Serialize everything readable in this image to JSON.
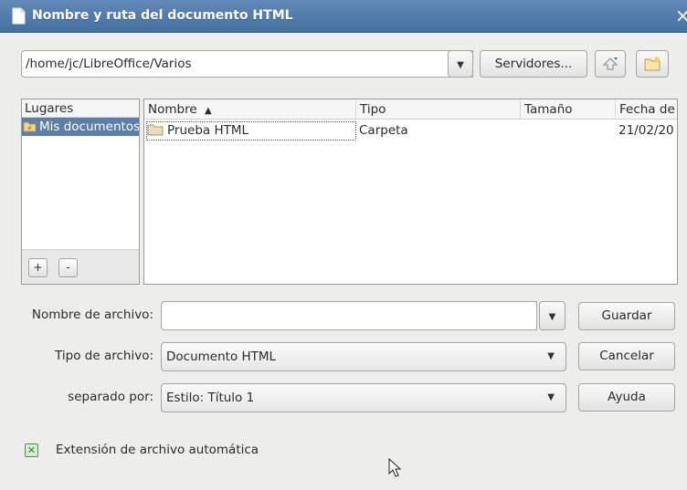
{
  "window": {
    "title": "Nombre y ruta del documento HTML",
    "close_glyph": "×"
  },
  "toolbar": {
    "path": "/home/jc/LibreOffice/Varios",
    "path_dropdown_glyph": "▼",
    "servers_label": "Servidores...",
    "up_icon": "folder-up-icon",
    "new_folder_icon": "new-folder-icon"
  },
  "places": {
    "header": "Lugares",
    "items": [
      {
        "label": "Mis documentos"
      }
    ],
    "add_label": "+",
    "remove_label": "-"
  },
  "files": {
    "columns": {
      "name": "Nombre",
      "sort_glyph": "▲",
      "type": "Tipo",
      "size": "Tamaño",
      "date": "Fecha de"
    },
    "rows": [
      {
        "name": "Prueba HTML",
        "type": "Carpeta",
        "size": "",
        "date": "21/02/20"
      }
    ]
  },
  "form": {
    "filename_label": "Nombre de archivo:",
    "filename_value": "",
    "filetype_label": "Tipo de archivo:",
    "filetype_value": "Documento HTML",
    "separated_label": "separado por:",
    "separated_value": "Estilo: Título 1",
    "dropdown_glyph": "▼"
  },
  "buttons": {
    "save": "Guardar",
    "cancel": "Cancelar",
    "help": "Ayuda"
  },
  "options": {
    "auto_extension_label": "Extensión de archivo automática",
    "auto_extension_checked": true,
    "check_glyph": "✕"
  },
  "colors": {
    "titlebar": "#4f78a8",
    "selection": "#5c7fa9",
    "checkbox": "#4f8f4f"
  }
}
